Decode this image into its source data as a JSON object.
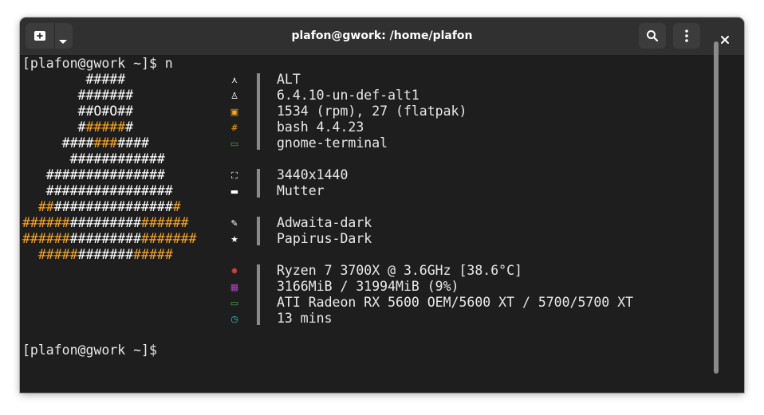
{
  "window": {
    "title": "plafon@gwork: /home/plafon"
  },
  "header": {
    "new_tab_icon": "new-tab-icon",
    "dropdown_icon": "chevron-down-icon",
    "search_icon": "search-icon",
    "menu_icon": "kebab-menu-icon",
    "close_icon": "close-icon"
  },
  "terminal": {
    "prompt_command": "[plafon@gwork ~]$ n",
    "prompt_final": "[plafon@gwork ~]$",
    "art": [
      [
        {
          "t": "        #####",
          "o": false
        }
      ],
      [
        {
          "t": "       #######",
          "o": false
        }
      ],
      [
        {
          "t": "       ##O#O##",
          "o": false
        }
      ],
      [
        {
          "t": "       #",
          "o": false
        },
        {
          "t": "#####",
          "o": true
        },
        {
          "t": "#",
          "o": false
        }
      ],
      [
        {
          "t": "     ####",
          "o": false
        },
        {
          "t": "###",
          "o": true
        },
        {
          "t": "####",
          "o": false
        }
      ],
      [
        {
          "t": "      ############",
          "o": false
        }
      ],
      [
        {
          "t": "   ###############",
          "o": false
        }
      ],
      [
        {
          "t": "   ################",
          "o": false
        }
      ],
      [
        {
          "t": "  ##",
          "o": true
        },
        {
          "t": "###############",
          "o": false
        },
        {
          "t": "#",
          "o": true
        }
      ],
      [
        {
          "t": "######",
          "o": true
        },
        {
          "t": "#########",
          "o": false
        },
        {
          "t": "######",
          "o": true
        }
      ],
      [
        {
          "t": "######",
          "o": true
        },
        {
          "t": "#########",
          "o": false
        },
        {
          "t": "#######",
          "o": true
        }
      ],
      [
        {
          "t": "  #####",
          "o": true
        },
        {
          "t": "#######",
          "o": false
        },
        {
          "t": "#####",
          "o": true
        }
      ]
    ],
    "info_groups": [
      [
        {
          "icon": "os-logo-icon",
          "glyph": "⋏",
          "color": "#ffffff",
          "text": "ALT"
        },
        {
          "icon": "penguin-icon",
          "glyph": "♙",
          "color": "#ffffff",
          "text": "6.4.10-un-def-alt1"
        },
        {
          "icon": "package-icon",
          "glyph": "▣",
          "color": "#f5a623",
          "text": "1534 (rpm), 27 (flatpak)"
        },
        {
          "icon": "hash-icon",
          "glyph": "#",
          "color": "#f5a623",
          "text": "bash 4.4.23"
        },
        {
          "icon": "terminal-icon",
          "glyph": "▭",
          "color": "#4caf50",
          "text": "gnome-terminal"
        }
      ],
      [
        {
          "icon": "resolution-icon",
          "glyph": "⛶",
          "color": "#ffffff",
          "text": "3440x1440"
        },
        {
          "icon": "window-icon",
          "glyph": "▬",
          "color": "#ffffff",
          "text": "Mutter"
        }
      ],
      [
        {
          "icon": "brush-icon",
          "glyph": "✎",
          "color": "#ffffff",
          "text": "Adwaita-dark"
        },
        {
          "icon": "star-icon",
          "glyph": "★",
          "color": "#ffffff",
          "text": "Papirus-Dark"
        }
      ],
      [
        {
          "icon": "cpu-icon",
          "glyph": "✹",
          "color": "#e53935",
          "text": "Ryzen 7 3700X @ 3.6GHz [38.6°C]"
        },
        {
          "icon": "memory-icon",
          "glyph": "▦",
          "color": "#ab47bc",
          "text": "3166MiB / 31994MiB (9%)"
        },
        {
          "icon": "monitor-icon",
          "glyph": "▭",
          "color": "#4caf50",
          "text": "ATI Radeon RX 5600 OEM/5600 XT / 5700/5700 XT"
        },
        {
          "icon": "uptime-icon",
          "glyph": "◷",
          "color": "#26c6da",
          "text": "13 mins"
        }
      ]
    ]
  }
}
